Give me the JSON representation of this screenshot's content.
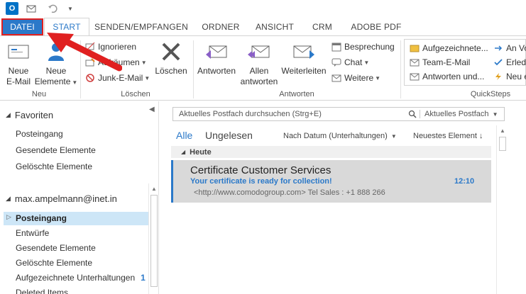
{
  "window": {
    "qa_logo": "O",
    "icons": {
      "send_receive": "send-receive-icon",
      "undo": "undo-icon"
    }
  },
  "tabs": {
    "file": "DATEI",
    "start": "START",
    "send_receive": "SENDEN/EMPFANGEN",
    "folder": "ORDNER",
    "view": "ANSICHT",
    "crm": "CRM",
    "adobe": "ADOBE PDF"
  },
  "ribbon": {
    "groups": {
      "new": "Neu",
      "delete": "Löschen",
      "respond": "Antworten",
      "quicksteps": "QuickSteps"
    },
    "new_email": [
      "Neue",
      "E-Mail"
    ],
    "new_items": [
      "Neue",
      "Elemente"
    ],
    "ignore": "Ignorieren",
    "cleanup": "Aufräumen",
    "junk": "Junk-E-Mail",
    "delete": "Löschen",
    "reply": "Antworten",
    "reply_all": [
      "Allen",
      "antworten"
    ],
    "forward": "Weiterleiten",
    "meeting": "Besprechung",
    "chat": "Chat",
    "more": "Weitere",
    "quicksteps": {
      "item1": "Aufgezeichnete...",
      "item2": "Team-E-Mail",
      "item3": "Antworten und...",
      "item4": "An Vo",
      "item5": "Erled",
      "item6": "Neu e"
    }
  },
  "folders": {
    "favorites_header": "Favoriten",
    "favorites": [
      "Posteingang",
      "Gesendete Elemente",
      "Gelöschte Elemente"
    ],
    "account": "max.ampelmann@inet.in",
    "account_folders": [
      "Posteingang",
      "Entwürfe",
      "Gesendete Elemente",
      "Gelöschte Elemente",
      "Aufgezeichnete Unterhaltungen",
      "Deleted Items"
    ],
    "recorded_count": "1"
  },
  "messages": {
    "search_placeholder": "Aktuelles Postfach durchsuchen (Strg+E)",
    "search_scope": "Aktuelles Postfach",
    "filter_all": "Alle",
    "filter_unread": "Ungelesen",
    "sort_by": "Nach Datum (Unterhaltungen)",
    "sort_order": "Neuestes Element",
    "group_today": "Heute",
    "items": [
      {
        "sender": "Certificate Customer Services",
        "subject": "Your certificate is ready for collection!",
        "time": "12:10",
        "preview": "<http://www.comodogroup.com>      Tel Sales : +1 888 266"
      }
    ]
  },
  "colors": {
    "accent": "#2b79c9",
    "selected": "#cde6f7",
    "annotation": "#e02020"
  }
}
